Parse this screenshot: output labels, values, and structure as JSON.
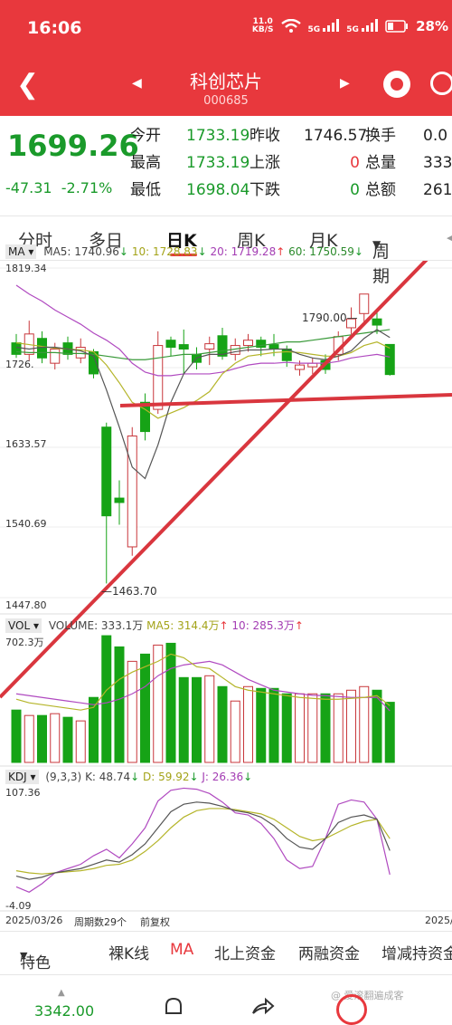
{
  "status": {
    "time": "16:06",
    "netspeed_value": "11.0",
    "netspeed_unit": "KB/S",
    "signal1": "5G",
    "signal2": "5G",
    "battery": "28%"
  },
  "nav": {
    "title": "科创芯片",
    "code": "000685",
    "back_icon": "back-arrow-icon",
    "prev_icon": "triangle-left-icon",
    "next_icon": "triangle-right-icon"
  },
  "quote": {
    "price": "1699.26",
    "change": "-47.31",
    "change_pct": "-2.71%",
    "open_label": "今开",
    "open": "1733.19",
    "high_label": "最高",
    "high": "1733.19",
    "low_label": "最低",
    "low": "1698.04",
    "prevclose_label": "昨收",
    "prevclose": "1746.57",
    "up_label": "上涨",
    "up": "0",
    "down_label": "下跌",
    "down": "0",
    "turnover_label": "换手",
    "turnover": "0.0",
    "volume_label": "总量",
    "volume": "333.",
    "amount_label": "总额",
    "amount": "261."
  },
  "tabs": [
    "分时",
    "多日",
    "日K",
    "周K",
    "月K",
    "周期"
  ],
  "kline": {
    "ma_tag": "MA",
    "ma5": "MA5: 1740.96",
    "ma10": "10: 1728.83",
    "ma20": "20: 1719.28",
    "ma60": "60: 1750.59",
    "y_labels": [
      "1819.34",
      "1726.",
      "1633.57",
      "1540.69",
      "1447.80"
    ],
    "high_mark": "1790.00",
    "low_mark": "1463.70",
    "colors": {
      "ma5": "#555555",
      "ma10": "#b5b52a",
      "ma20": "#b04ac0",
      "ma60": "#3a9a3a",
      "up": "#c8373b",
      "down": "#16a316"
    }
  },
  "volume": {
    "tag": "VOL",
    "vol": "VOLUME: 333.1万",
    "ma5": "MA5: 314.4万",
    "ma10": "10: 285.3万",
    "y_label": "702.3万"
  },
  "kdj": {
    "tag": "KDJ",
    "params": "(9,3,3)",
    "k": "K: 48.74",
    "d": "D: 59.92",
    "j": "J: 26.36",
    "y_top": "107.36",
    "y_bottom": "-4.09"
  },
  "footer": {
    "start_date": "2025/03/26",
    "period_count": "周期数29个",
    "adjust": "前复权",
    "end_date": "2025/"
  },
  "bottom_tabs": [
    "特色",
    "裸K线",
    "MA",
    "北上资金",
    "两融资金",
    "增减持资金"
  ],
  "bottombar": {
    "index_value": "3342.00",
    "watermark": "@ 爱滚翻遍成客"
  },
  "chart_data": {
    "type": "candlestick",
    "title": "",
    "ylim": [
      1447.8,
      1819.34
    ],
    "candles": [
      {
        "o": 1735,
        "c": 1722,
        "h": 1745,
        "l": 1718
      },
      {
        "o": 1722,
        "c": 1745,
        "h": 1760,
        "l": 1715
      },
      {
        "o": 1740,
        "c": 1718,
        "h": 1748,
        "l": 1712
      },
      {
        "o": 1712,
        "c": 1728,
        "h": 1735,
        "l": 1705
      },
      {
        "o": 1735,
        "c": 1722,
        "h": 1742,
        "l": 1716
      },
      {
        "o": 1718,
        "c": 1730,
        "h": 1740,
        "l": 1712
      },
      {
        "o": 1725,
        "c": 1700,
        "h": 1728,
        "l": 1695
      },
      {
        "o": 1640,
        "c": 1540,
        "h": 1645,
        "l": 1463.7
      },
      {
        "o": 1560,
        "c": 1555,
        "h": 1580,
        "l": 1530
      },
      {
        "o": 1505,
        "c": 1630,
        "h": 1640,
        "l": 1495
      },
      {
        "o": 1668,
        "c": 1635,
        "h": 1678,
        "l": 1625
      },
      {
        "o": 1660,
        "c": 1732,
        "h": 1748,
        "l": 1655
      },
      {
        "o": 1738,
        "c": 1730,
        "h": 1742,
        "l": 1720
      },
      {
        "o": 1733,
        "c": 1728,
        "h": 1750,
        "l": 1700
      },
      {
        "o": 1722,
        "c": 1713,
        "h": 1730,
        "l": 1705
      },
      {
        "o": 1728,
        "c": 1734,
        "h": 1742,
        "l": 1710
      },
      {
        "o": 1743,
        "c": 1720,
        "h": 1752,
        "l": 1716
      },
      {
        "o": 1722,
        "c": 1732,
        "h": 1740,
        "l": 1715
      },
      {
        "o": 1732,
        "c": 1738,
        "h": 1745,
        "l": 1725
      },
      {
        "o": 1738,
        "c": 1730,
        "h": 1742,
        "l": 1720
      },
      {
        "o": 1733,
        "c": 1728,
        "h": 1745,
        "l": 1720
      },
      {
        "o": 1728,
        "c": 1715,
        "h": 1732,
        "l": 1708
      },
      {
        "o": 1705,
        "c": 1710,
        "h": 1715,
        "l": 1698
      },
      {
        "o": 1708,
        "c": 1712,
        "h": 1718,
        "l": 1700
      },
      {
        "o": 1715,
        "c": 1705,
        "h": 1722,
        "l": 1700
      },
      {
        "o": 1722,
        "c": 1742,
        "h": 1748,
        "l": 1715
      },
      {
        "o": 1752,
        "c": 1762,
        "h": 1775,
        "l": 1745
      },
      {
        "o": 1768,
        "c": 1790,
        "h": 1790,
        "l": 1758
      },
      {
        "o": 1762,
        "c": 1755,
        "h": 1772,
        "l": 1745
      },
      {
        "o": 1733.19,
        "c": 1699.26,
        "h": 1733.19,
        "l": 1698.04
      }
    ],
    "ma5": [
      1730,
      1728,
      1730,
      1730,
      1728,
      1726,
      1720,
      1682,
      1640,
      1595,
      1582,
      1620,
      1668,
      1700,
      1718,
      1722,
      1722,
      1725,
      1727,
      1727,
      1728,
      1728,
      1722,
      1718,
      1716,
      1720,
      1726,
      1740,
      1750,
      1741
    ],
    "ma10": [
      1735,
      1733,
      1731,
      1729,
      1728,
      1727,
      1725,
      1710,
      1690,
      1668,
      1660,
      1650,
      1656,
      1662,
      1670,
      1680,
      1700,
      1712,
      1720,
      1722,
      1724,
      1725,
      1724,
      1722,
      1720,
      1720,
      1724,
      1732,
      1736,
      1729
    ],
    "ma20": [
      1800,
      1790,
      1782,
      1772,
      1764,
      1756,
      1746,
      1738,
      1728,
      1712,
      1702,
      1698,
      1698,
      1700,
      1700,
      1700,
      1702,
      1706,
      1710,
      1712,
      1712,
      1713,
      1712,
      1712,
      1712,
      1714,
      1718,
      1720,
      1722,
      1719
    ],
    "ma60": [
      1725,
      1724,
      1724,
      1724,
      1723,
      1723,
      1722,
      1720,
      1718,
      1716,
      1716,
      1718,
      1720,
      1722,
      1722,
      1724,
      1726,
      1728,
      1730,
      1732,
      1734,
      1736,
      1736,
      1738,
      1740,
      1742,
      1744,
      1746,
      1748,
      1750
    ],
    "volume": {
      "ylim": [
        0,
        702.3
      ],
      "values": [
        290,
        260,
        260,
        270,
        250,
        230,
        360,
        702,
        640,
        560,
        600,
        650,
        660,
        470,
        470,
        480,
        420,
        340,
        420,
        410,
        410,
        380,
        380,
        380,
        380,
        380,
        400,
        420,
        400,
        333.1
      ],
      "ma5": [
        350,
        330,
        320,
        310,
        300,
        290,
        305,
        400,
        460,
        500,
        530,
        560,
        600,
        580,
        530,
        520,
        470,
        420,
        400,
        390,
        380,
        370,
        360,
        355,
        350,
        350,
        355,
        360,
        370,
        314.4
      ],
      "ma10": [
        380,
        370,
        360,
        350,
        340,
        330,
        320,
        330,
        350,
        380,
        420,
        480,
        520,
        540,
        550,
        560,
        540,
        500,
        460,
        430,
        400,
        390,
        380,
        372,
        370,
        365,
        360,
        360,
        360,
        285.3
      ]
    },
    "kdj": {
      "ylim": [
        -4.09,
        107.36
      ],
      "k": [
        25,
        22,
        24,
        28,
        30,
        32,
        36,
        40,
        38,
        45,
        55,
        70,
        85,
        92,
        94,
        93,
        90,
        86,
        84,
        80,
        72,
        60,
        52,
        50,
        60,
        75,
        80,
        82,
        78,
        48.74
      ],
      "d": [
        30,
        28,
        27,
        28,
        29,
        30,
        32,
        35,
        36,
        40,
        48,
        58,
        70,
        80,
        86,
        88,
        88,
        87,
        85,
        83,
        78,
        70,
        62,
        58,
        60,
        66,
        72,
        76,
        78,
        59.92
      ],
      "j": [
        15,
        10,
        18,
        28,
        32,
        36,
        44,
        50,
        42,
        55,
        70,
        95,
        105,
        107,
        106,
        102,
        94,
        84,
        82,
        74,
        60,
        40,
        32,
        34,
        60,
        92,
        96,
        94,
        78,
        26.36
      ]
    }
  }
}
